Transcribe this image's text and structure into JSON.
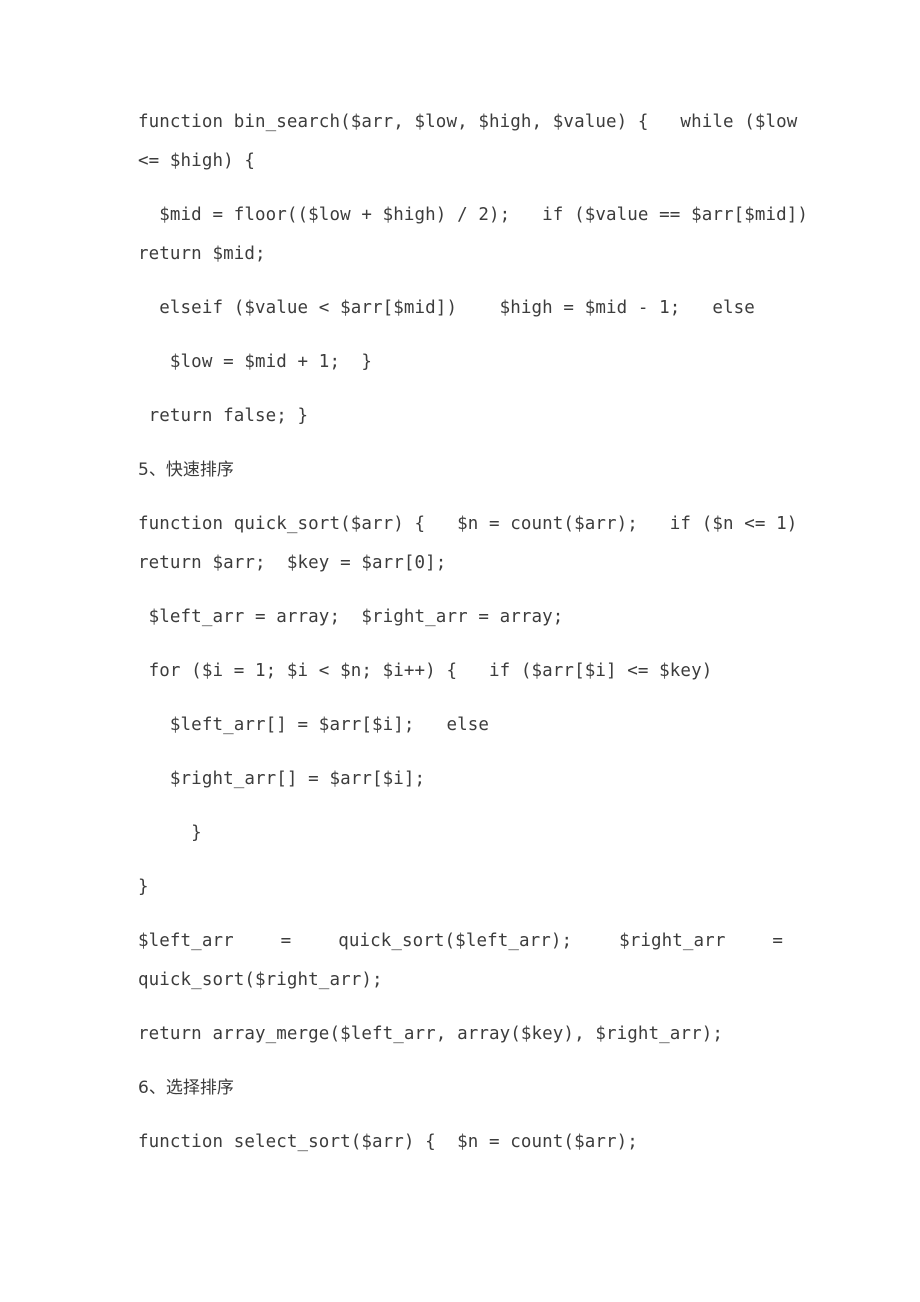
{
  "document": {
    "background_color": "#ffffff",
    "text_color": "#3c3c3c",
    "blocks": [
      {
        "id": "bin-search-block-1",
        "type": "code",
        "lines": [
          "function bin_search($arr, $low, $high, $value) {   while ($low",
          "<= $high) {"
        ]
      },
      {
        "id": "bin-search-block-2",
        "type": "code",
        "lines": [
          "  $mid = floor(($low + $high) / 2);   if ($value == $arr[$mid])",
          "return $mid;"
        ]
      },
      {
        "id": "bin-search-block-3",
        "type": "code",
        "lines": [
          "  elseif ($value < $arr[$mid])    $high = $mid - 1;   else"
        ]
      },
      {
        "id": "bin-search-block-4",
        "type": "code",
        "lines": [
          "   $low = $mid + 1;  }"
        ]
      },
      {
        "id": "bin-search-block-5",
        "type": "code",
        "lines": [
          " return false; }"
        ]
      },
      {
        "id": "heading-quick-sort",
        "type": "heading",
        "lines": [
          "5、快速排序"
        ]
      },
      {
        "id": "quick-sort-block-1",
        "type": "code",
        "lines": [
          "function quick_sort($arr) {   $n = count($arr);   if ($n <= 1)",
          "return $arr;  $key = $arr[0];"
        ]
      },
      {
        "id": "quick-sort-block-2",
        "type": "code",
        "lines": [
          " $left_arr = array;  $right_arr = array;"
        ]
      },
      {
        "id": "quick-sort-block-3",
        "type": "code",
        "lines": [
          " for ($i = 1; $i < $n; $i++) {   if ($arr[$i] <= $key)"
        ]
      },
      {
        "id": "quick-sort-block-4",
        "type": "code",
        "lines": [
          "   $left_arr[] = $arr[$i];   else"
        ]
      },
      {
        "id": "quick-sort-block-5",
        "type": "code",
        "lines": [
          "   $right_arr[] = $arr[$i];"
        ]
      },
      {
        "id": "quick-sort-block-6",
        "type": "code",
        "lines": [
          "     }"
        ]
      },
      {
        "id": "quick-sort-block-7",
        "type": "code",
        "lines": [
          "}"
        ]
      },
      {
        "id": "quick-sort-block-8",
        "type": "code-justified",
        "justified_segments": [
          "$left_arr",
          "=",
          "quick_sort($left_arr);",
          "$right_arr",
          "="
        ],
        "lines": [
          "quick_sort($right_arr);"
        ]
      },
      {
        "id": "quick-sort-block-9",
        "type": "code",
        "lines": [
          "return array_merge($left_arr, array($key), $right_arr);"
        ]
      },
      {
        "id": "heading-select-sort",
        "type": "heading",
        "lines": [
          "6、选择排序"
        ]
      },
      {
        "id": "select-sort-block-1",
        "type": "code",
        "lines": [
          "function select_sort($arr) {  $n = count($arr);"
        ]
      }
    ]
  }
}
